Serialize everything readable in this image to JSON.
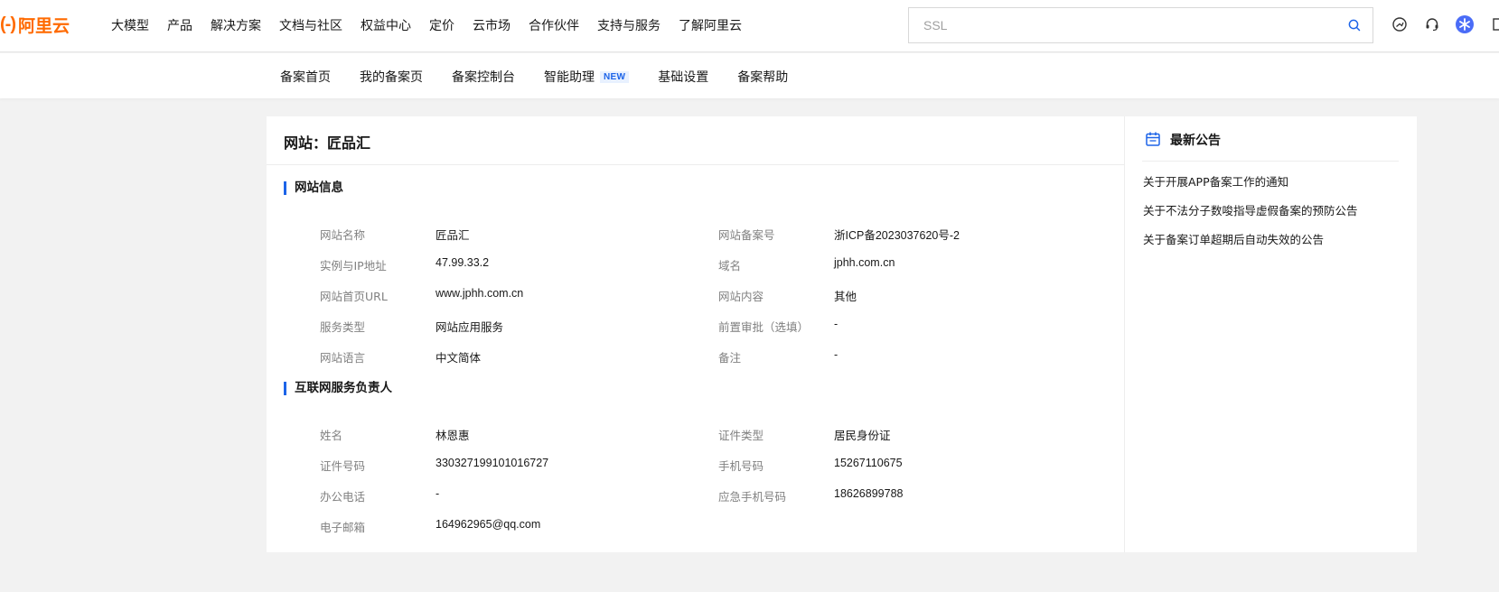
{
  "brand": {
    "logo_bracket": "(-)",
    "logo_text": "阿里云",
    "color": "#ff6a00"
  },
  "top_nav": [
    "大模型",
    "产品",
    "解决方案",
    "文档与社区",
    "权益中心",
    "定价",
    "云市场",
    "合作伙伴",
    "支持与服务",
    "了解阿里云"
  ],
  "search": {
    "value": "",
    "placeholder": "SSL"
  },
  "header_icons": [
    "dashboard-icon",
    "headset-icon",
    "user-avatar-icon",
    "language-icon"
  ],
  "sub_nav": {
    "items": [
      "备案首页",
      "我的备案页",
      "备案控制台",
      "智能助理",
      "基础设置",
      "备案帮助"
    ],
    "new_badge": "NEW"
  },
  "card": {
    "title": "网站：匠品汇",
    "site_section": {
      "heading": "网站信息",
      "left": [
        {
          "label": "网站名称",
          "value": "匠品汇"
        },
        {
          "label": "实例与IP地址",
          "value": "47.99.33.2"
        },
        {
          "label": "网站首页URL",
          "value": "www.jphh.com.cn"
        },
        {
          "label": "服务类型",
          "value": "网站应用服务"
        },
        {
          "label": "网站语言",
          "value": "中文简体"
        }
      ],
      "right": [
        {
          "label": "网站备案号",
          "value": "浙ICP备2023037620号-2"
        },
        {
          "label": "域名",
          "value": "jphh.com.cn"
        },
        {
          "label": "网站内容",
          "value": "其他"
        },
        {
          "label": "前置审批（选填）",
          "value": "-"
        },
        {
          "label": "备注",
          "value": "-"
        }
      ]
    },
    "owner_section": {
      "heading": "互联网服务负责人",
      "left": [
        {
          "label": "姓名",
          "value": "林恩惠"
        },
        {
          "label": "证件号码",
          "value": "330327199101016727"
        },
        {
          "label": "办公电话",
          "value": "-"
        },
        {
          "label": "电子邮箱",
          "value": "164962965@qq.com"
        }
      ],
      "right": [
        {
          "label": "证件类型",
          "value": "居民身份证"
        },
        {
          "label": "手机号码",
          "value": "15267110675"
        },
        {
          "label": "应急手机号码",
          "value": "18626899788"
        }
      ]
    }
  },
  "sidebar": {
    "title": "最新公告",
    "notices": [
      "关于开展APP备案工作的通知",
      "关于不法分子数唆指导虚假备案的预防公告",
      "关于备案订单超期后自动失效的公告"
    ]
  },
  "colors": {
    "accent": "#1d64e8",
    "brand": "#ff6a00",
    "label": "#808080",
    "page_bg": "#f2f2f2"
  }
}
